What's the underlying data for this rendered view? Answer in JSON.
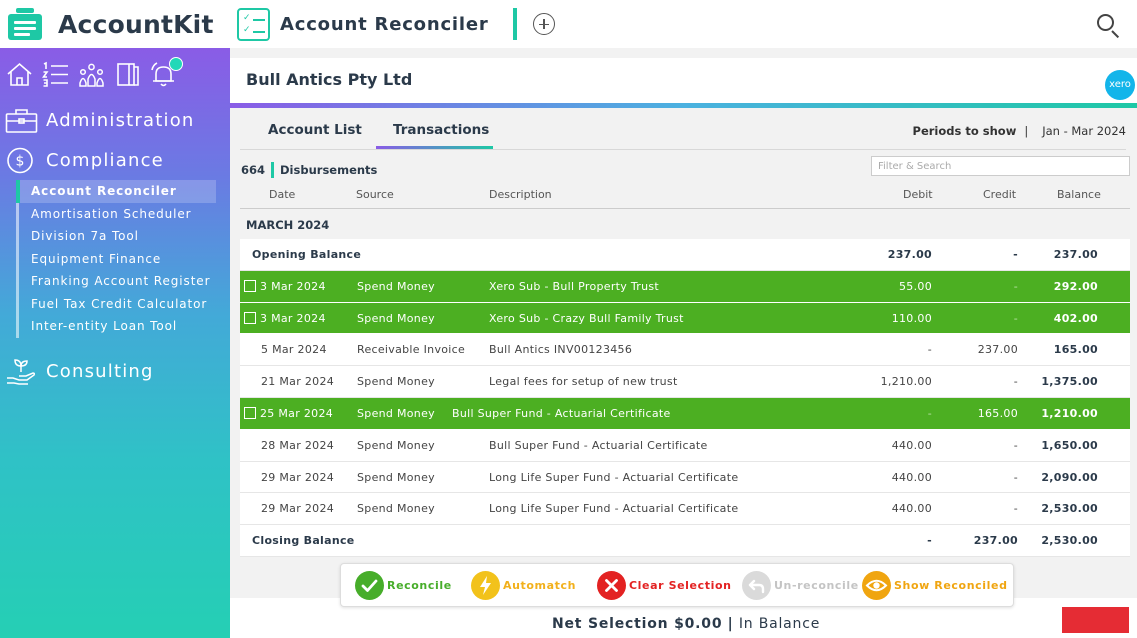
{
  "brand": {
    "name": "AccountKit"
  },
  "app": {
    "title": "Account Reconciler"
  },
  "sidebar": {
    "sections": {
      "administration": "Administration",
      "compliance": "Compliance",
      "consulting": "Consulting"
    },
    "compliance_items": [
      {
        "label": "Account Reconciler"
      },
      {
        "label": "Amortisation Scheduler"
      },
      {
        "label": "Division 7a Tool"
      },
      {
        "label": "Equipment Finance"
      },
      {
        "label": "Franking Account Register"
      },
      {
        "label": "Fuel Tax Credit Calculator"
      },
      {
        "label": "Inter-entity Loan Tool"
      }
    ]
  },
  "company": {
    "name": "Bull Antics Pty Ltd",
    "integration_badge": "xero"
  },
  "tabs": {
    "account_list": "Account List",
    "transactions": "Transactions"
  },
  "periods": {
    "label": "Periods to show",
    "separator": "|",
    "value": "Jan - Mar 2024"
  },
  "account": {
    "code": "664",
    "name": "Disbursements"
  },
  "filter": {
    "placeholder": "Filter & Search",
    "value": ""
  },
  "columns": {
    "date": "Date",
    "source": "Source",
    "description": "Description",
    "debit": "Debit",
    "credit": "Credit",
    "balance": "Balance"
  },
  "month": "MARCH 2024",
  "opening": {
    "label": "Opening Balance",
    "debit": "237.00",
    "credit": "-",
    "balance": "237.00"
  },
  "transactions": [
    {
      "date": "3 Mar 2024",
      "source": "Spend Money",
      "description": "Xero Sub - Bull Property Trust",
      "debit": "55.00",
      "credit": "-",
      "balance": "292.00",
      "selected": true
    },
    {
      "date": "3 Mar 2024",
      "source": "Spend Money",
      "description": "Xero Sub - Crazy Bull Family Trust",
      "debit": "110.00",
      "credit": "-",
      "balance": "402.00",
      "selected": true
    },
    {
      "date": "5 Mar 2024",
      "source": "Receivable Invoice",
      "description": "Bull Antics INV00123456",
      "debit": "-",
      "credit": "237.00",
      "balance": "165.00",
      "selected": false
    },
    {
      "date": "21 Mar 2024",
      "source": "Spend Money",
      "description": "Legal fees for setup of  new trust",
      "debit": "1,210.00",
      "credit": "-",
      "balance": "1,375.00",
      "selected": false
    },
    {
      "date": "25 Mar 2024",
      "source": "Spend Money",
      "description": "Bull Super Fund - Actuarial Certificate",
      "debit": "-",
      "credit": "165.00",
      "balance": "1,210.00",
      "selected": true
    },
    {
      "date": "28 Mar 2024",
      "source": "Spend Money",
      "description": "Bull Super Fund - Actuarial Certificate",
      "debit": "440.00",
      "credit": "-",
      "balance": "1,650.00",
      "selected": false
    },
    {
      "date": "29 Mar 2024",
      "source": "Spend Money",
      "description": "Long Life Super Fund - Actuarial Certificate",
      "debit": "440.00",
      "credit": "-",
      "balance": "2,090.00",
      "selected": false
    },
    {
      "date": "29 Mar 2024",
      "source": "Spend Money",
      "description": "Long Life Super Fund - Actuarial Certificate",
      "debit": "440.00",
      "credit": "-",
      "balance": "2,530.00",
      "selected": false
    }
  ],
  "closing": {
    "label": "Closing Balance",
    "debit": "-",
    "credit": "237.00",
    "balance": "2,530.00"
  },
  "actions": {
    "reconcile": "Reconcile",
    "automatch": "Automatch",
    "clear_selection": "Clear Selection",
    "unreconcile": "Un-reconcile",
    "show_reconciled": "Show Reconciled"
  },
  "footer": {
    "net_label": "Net Selection $0.00",
    "separator": "|",
    "status": "In Balance"
  },
  "colors": {
    "accent": "#1ec8a5",
    "selected_row": "#4caf22",
    "danger": "#e32222",
    "warning": "#f2c21b",
    "xero": "#13b5ea"
  }
}
